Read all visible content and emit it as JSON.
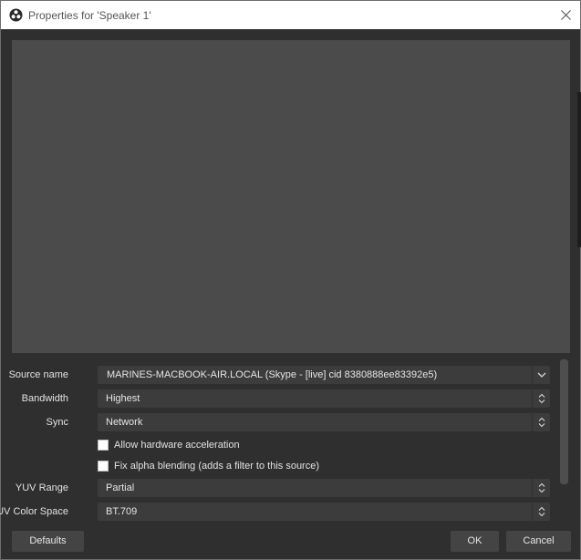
{
  "window": {
    "title": "Properties for 'Speaker 1'"
  },
  "fields": {
    "source_name": {
      "label": "Source name",
      "value": "MARINES-MACBOOK-AIR.LOCAL (Skype - [live] cid 8380888ee83392e5)"
    },
    "bandwidth": {
      "label": "Bandwidth",
      "value": "Highest"
    },
    "sync": {
      "label": "Sync",
      "value": "Network"
    },
    "hw_accel": {
      "label": "Allow hardware acceleration",
      "checked": false
    },
    "fix_alpha": {
      "label": "Fix alpha blending (adds a filter to this source)",
      "checked": false
    },
    "yuv_range": {
      "label": "YUV Range",
      "value": "Partial"
    },
    "yuv_color_space": {
      "label": "YUV Color Space",
      "value": "BT.709"
    }
  },
  "buttons": {
    "defaults": "Defaults",
    "ok": "OK",
    "cancel": "Cancel"
  },
  "icons": {
    "app": "obs-logo-icon",
    "close": "close-icon",
    "combo": "chevron-down-icon",
    "spinner": "up-down-arrows-icon"
  },
  "colors": {
    "background": "#2f2f2f",
    "preview": "#4b4b4b",
    "field": "#3c3c3c"
  }
}
